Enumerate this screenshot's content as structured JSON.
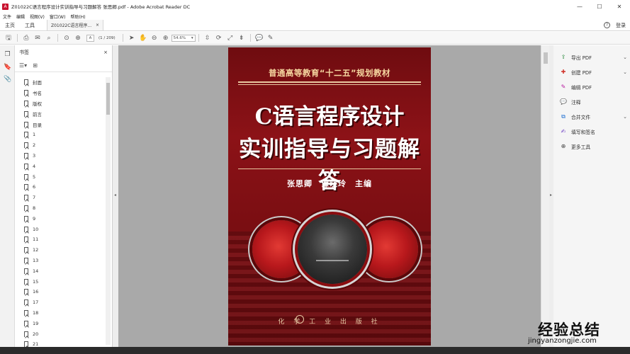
{
  "window": {
    "title": "Z01022C语言程序设计实训指导与习题解答 张思卿.pdf - Adobe Acrobat Reader DC",
    "minimize": "—",
    "maximize": "☐",
    "close": "✕"
  },
  "menu": [
    "文件",
    "编辑",
    "视图(V)",
    "窗口(W)",
    "帮助(H)"
  ],
  "tabs": {
    "home": "主页",
    "tools": "工具",
    "document": "Z01022C语言程序...",
    "document_close": "×",
    "login": "登录"
  },
  "toolbar": {
    "page_current": "A",
    "page_count": "(1 / 209)",
    "zoom": "54.6%"
  },
  "bookmarks": {
    "header": "书签",
    "close": "×",
    "items": [
      "封面",
      "书名",
      "版权",
      "前言",
      "目录",
      "1",
      "2",
      "3",
      "4",
      "5",
      "6",
      "7",
      "8",
      "9",
      "10",
      "11",
      "12",
      "13",
      "14",
      "15",
      "16",
      "17",
      "18",
      "19",
      "20",
      "21"
    ]
  },
  "cover": {
    "series": "普通高等教育“十二五”规划教材",
    "title_line1": "C语言程序设计",
    "title_line2": "实训指导与习题解答",
    "authors": "张思卿　谭晓玲　主编",
    "publisher": "化 学 工 业 出 版 社"
  },
  "right_panel": [
    {
      "label": "导出 PDF",
      "icon": "export-pdf-icon",
      "color": "#2b8a3e",
      "chevron": true
    },
    {
      "label": "创建 PDF",
      "icon": "create-pdf-icon",
      "color": "#d0342c",
      "chevron": true
    },
    {
      "label": "编辑 PDF",
      "icon": "edit-pdf-icon",
      "color": "#b5179e",
      "chevron": false
    },
    {
      "label": "注释",
      "icon": "comment-icon",
      "color": "#e0a800",
      "chevron": false
    },
    {
      "label": "合并文件",
      "icon": "combine-files-icon",
      "color": "#1f6fd1",
      "chevron": true
    },
    {
      "label": "填写和签名",
      "icon": "fill-sign-icon",
      "color": "#6d3fc4",
      "chevron": false
    },
    {
      "label": "更多工具",
      "icon": "more-tools-icon",
      "color": "#444444",
      "chevron": false
    }
  ],
  "watermark": {
    "brand": "经验总结",
    "url": "jingyanzongjie.com"
  }
}
